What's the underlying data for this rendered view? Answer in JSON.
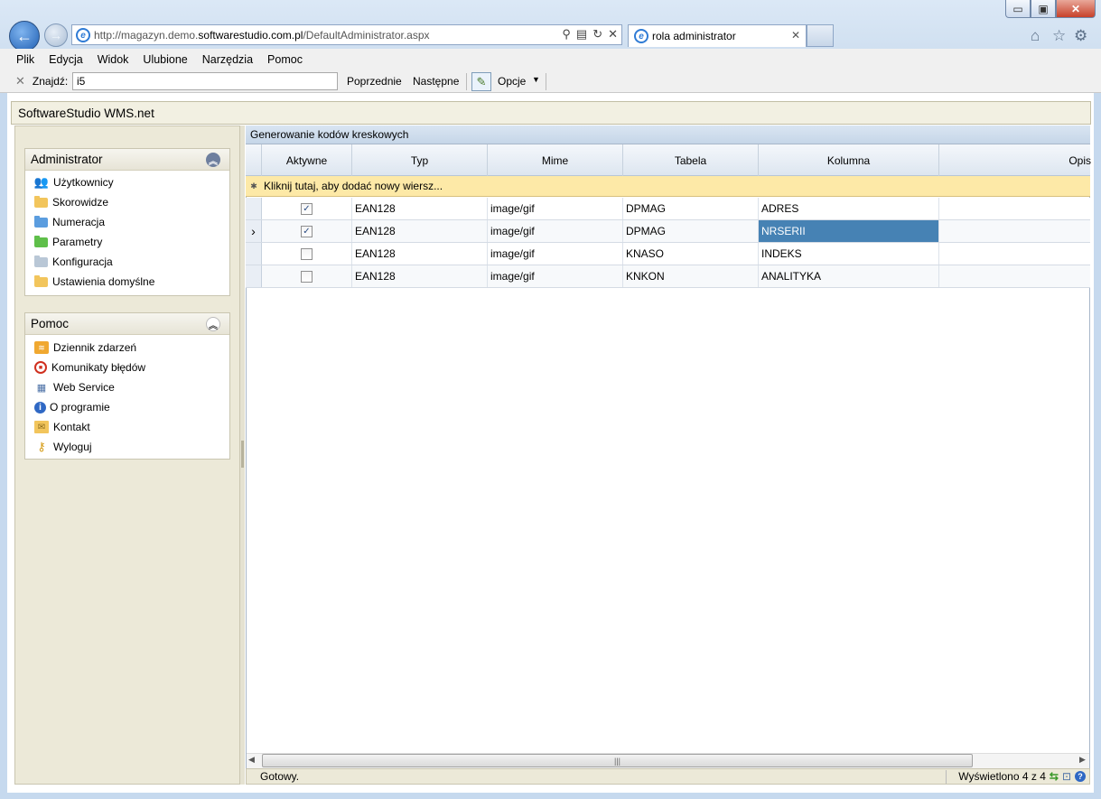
{
  "browser": {
    "url_prefix": "http://magazyn.demo.",
    "url_domain": "softwarestudio.com.pl",
    "url_path": "/DefaultAdministrator.aspx",
    "tab_title": "rola administrator",
    "window_buttons": {
      "min": "▭",
      "max": "▣",
      "close": "✕"
    }
  },
  "menu": [
    "Plik",
    "Edycja",
    "Widok",
    "Ulubione",
    "Narzędzia",
    "Pomoc"
  ],
  "find": {
    "label": "Znajdź:",
    "value": "i5",
    "prev": "Poprzednie",
    "next": "Następne",
    "options": "Opcje"
  },
  "app": {
    "title": "SoftwareStudio WMS.net"
  },
  "admin_panel": {
    "title": "Administrator",
    "items": [
      {
        "label": "Użytkownicy",
        "icon": "users-icon"
      },
      {
        "label": "Skorowidze",
        "icon": "folder-icon"
      },
      {
        "label": "Numeracja",
        "icon": "folder-icon"
      },
      {
        "label": "Parametry",
        "icon": "folder-icon"
      },
      {
        "label": "Konfiguracja",
        "icon": "folder-icon"
      },
      {
        "label": "Ustawienia domyślne",
        "icon": "folder-icon"
      }
    ]
  },
  "help_panel": {
    "title": "Pomoc",
    "items": [
      {
        "label": "Dziennik zdarzeń",
        "icon": "log-icon"
      },
      {
        "label": "Komunikaty błędów",
        "icon": "error-icon"
      },
      {
        "label": "Web Service",
        "icon": "web-service-icon"
      },
      {
        "label": "O programie",
        "icon": "info-icon"
      },
      {
        "label": "Kontakt",
        "icon": "mail-icon"
      },
      {
        "label": "Wyloguj",
        "icon": "key-icon"
      }
    ]
  },
  "grid": {
    "title": "Generowanie kodów kreskowych",
    "columns": [
      "Aktywne",
      "Typ",
      "Mime",
      "Tabela",
      "Kolumna",
      "Opis"
    ],
    "new_row_text": "Kliknij tutaj, aby dodać nowy wiersz...",
    "rows": [
      {
        "aktywne": true,
        "typ": "EAN128",
        "mime": "image/gif",
        "tabela": "DPMAG",
        "kolumna": "ADRES",
        "opis": ""
      },
      {
        "aktywne": true,
        "typ": "EAN128",
        "mime": "image/gif",
        "tabela": "DPMAG",
        "kolumna": "NRSERII",
        "opis": ""
      },
      {
        "aktywne": false,
        "typ": "EAN128",
        "mime": "image/gif",
        "tabela": "KNASO",
        "kolumna": "INDEKS",
        "opis": ""
      },
      {
        "aktywne": false,
        "typ": "EAN128",
        "mime": "image/gif",
        "tabela": "KNKON",
        "kolumna": "ANALITYKA",
        "opis": ""
      }
    ],
    "selected_row": 1,
    "status": "Gotowy.",
    "record_info": "Wyświetlono 4 z 4"
  },
  "colors": {
    "selection": "#4682b4",
    "new_row": "#fde9a7",
    "panel_bg": "#ece9d8"
  }
}
